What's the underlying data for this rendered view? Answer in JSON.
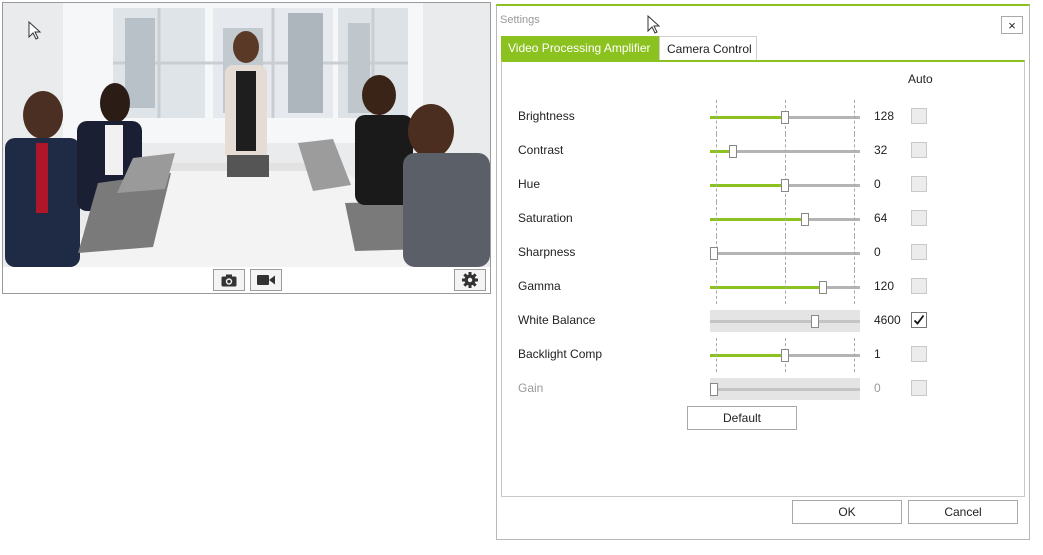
{
  "camera": {
    "toolbar": {
      "snapshot_icon": "camera-icon",
      "record_icon": "video-camera-icon",
      "settings_icon": "gear-icon"
    }
  },
  "dialog": {
    "title": "Settings",
    "close_label": "×",
    "tabs": [
      {
        "label": "Video Processing Amplifier",
        "active": true
      },
      {
        "label": "Camera Control",
        "active": false
      }
    ],
    "auto_header": "Auto",
    "properties": [
      {
        "label": "Brightness",
        "value": "128",
        "level": 0.5,
        "auto": false,
        "enabled": true,
        "auto_mode": false
      },
      {
        "label": "Contrast",
        "value": "32",
        "level": 0.15,
        "auto": false,
        "enabled": true,
        "auto_mode": false
      },
      {
        "label": "Hue",
        "value": "0",
        "level": 0.5,
        "auto": false,
        "enabled": true,
        "auto_mode": false
      },
      {
        "label": "Saturation",
        "value": "64",
        "level": 0.63,
        "auto": false,
        "enabled": true,
        "auto_mode": false
      },
      {
        "label": "Sharpness",
        "value": "0",
        "level": 0.0,
        "auto": false,
        "enabled": true,
        "auto_mode": false
      },
      {
        "label": "Gamma",
        "value": "120",
        "level": 0.75,
        "auto": false,
        "enabled": true,
        "auto_mode": false
      },
      {
        "label": "White Balance",
        "value": "4600",
        "level": 0.7,
        "auto": true,
        "enabled": true,
        "auto_mode": true
      },
      {
        "label": "Backlight Comp",
        "value": "1",
        "level": 0.5,
        "auto": false,
        "enabled": true,
        "auto_mode": false
      },
      {
        "label": "Gain",
        "value": "0",
        "level": 0.0,
        "auto": false,
        "enabled": false,
        "auto_mode": false
      }
    ],
    "default_label": "Default",
    "ok_label": "OK",
    "cancel_label": "Cancel"
  },
  "colors": {
    "accent": "#8cc21f",
    "track": "#b4b4b4"
  }
}
